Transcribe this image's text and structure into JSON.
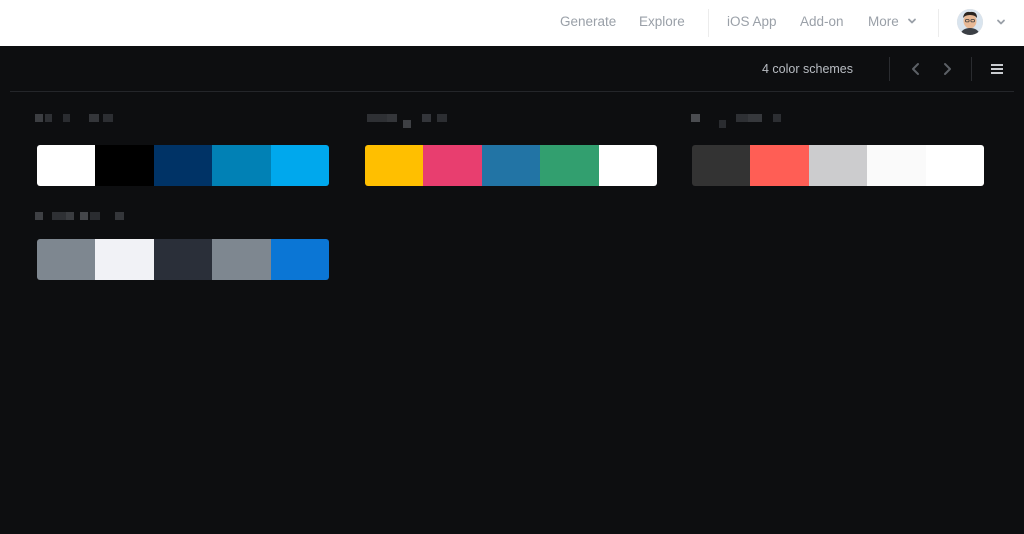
{
  "nav": {
    "generate": "Generate",
    "explore": "Explore",
    "ios_app": "iOS App",
    "add_on": "Add-on",
    "more": "More"
  },
  "toolbar": {
    "count_label": "4 color schemes"
  },
  "schemes": [
    {
      "colors": [
        "#ffffff",
        "#000000",
        "#003366",
        "#0181b5",
        "#00a8ed"
      ]
    },
    {
      "colors": [
        "#ffbf00",
        "#e83e6f",
        "#2274a5",
        "#329f6f",
        "#ffffff"
      ]
    },
    {
      "colors": [
        "#333333",
        "#ff5e55",
        "#ccccce",
        "#fafafa",
        "#ffffff"
      ]
    },
    {
      "colors": [
        "#7e8790",
        "#f1f2f6",
        "#2a2f39",
        "#7e8790",
        "#0b76d5"
      ]
    }
  ],
  "theme": {
    "background": "#0d0e10",
    "nav_text": "#9aa0a8"
  },
  "icons": {
    "more_chevron": "chevron-down-icon",
    "prev": "chevron-left-icon",
    "next": "chevron-right-icon",
    "menu": "hamburger-menu-icon"
  }
}
